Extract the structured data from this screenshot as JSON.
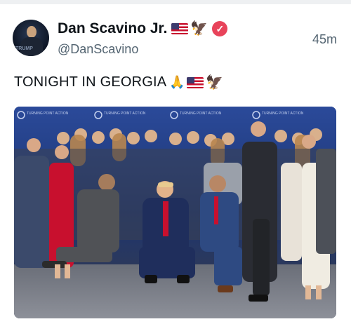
{
  "post": {
    "display_name": "Dan Scavino Jr.",
    "handle": "@DanScavino",
    "timestamp": "45m",
    "text": "TONIGHT IN GEORGIA",
    "verified": true,
    "avatar_text": "TRUMP"
  },
  "banner": {
    "logo_text": "TURNING POINT ACTION"
  },
  "icons": {
    "flag": "us-flag-icon",
    "eagle": "eagle-icon",
    "verified": "verified-badge-icon",
    "prayer": "folded-hands-icon"
  },
  "colors": {
    "text": "#0f1419",
    "secondary": "#536471",
    "verified": "#e8435a",
    "backdrop": "#203a78"
  }
}
